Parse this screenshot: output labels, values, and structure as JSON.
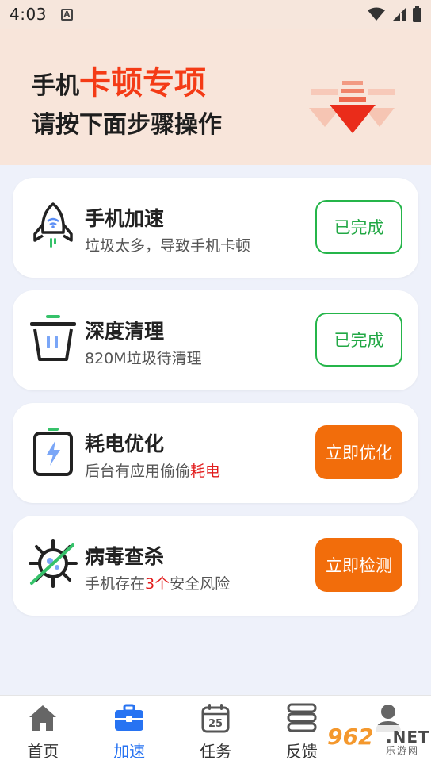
{
  "status_bar": {
    "time": "4:03",
    "notification_letter": "A"
  },
  "hero": {
    "title_prefix": "手机",
    "title_highlight": "卡顿专项",
    "subtitle": "请按下面步骤操作"
  },
  "cards": [
    {
      "title": "手机加速",
      "subtitle": "垃圾太多，导致手机卡顿",
      "button": "已完成",
      "icon": "rocket-icon"
    },
    {
      "title": "深度清理",
      "subtitle": "820M垃圾待清理",
      "button": "已完成",
      "icon": "trash-icon"
    },
    {
      "title": "耗电优化",
      "subtitle_prefix": "后台有应用偷偷",
      "subtitle_highlight": "耗电",
      "button": "立即优化",
      "icon": "battery-icon"
    },
    {
      "title": "病毒查杀",
      "subtitle_prefix": "手机存在",
      "subtitle_highlight": "3个",
      "subtitle_suffix": "安全风险",
      "button": "立即检测",
      "icon": "virus-icon"
    }
  ],
  "tabs": [
    {
      "label": "首页",
      "icon": "home-icon",
      "active": false
    },
    {
      "label": "加速",
      "icon": "toolbox-icon",
      "active": true
    },
    {
      "label": "任务",
      "icon": "calendar-icon",
      "calendar_day": "25",
      "active": false
    },
    {
      "label": "反馈",
      "icon": "server-icon",
      "active": false
    },
    {
      "label": "",
      "icon": "user-icon",
      "active": false
    }
  ],
  "watermark": {
    "number": "962",
    "suffix": ".NET",
    "sub": "乐游网"
  },
  "colors": {
    "accent_orange": "#f26d0b",
    "done_green": "#25b54a",
    "hero_red": "#f43b16",
    "active_blue": "#2773f2"
  }
}
